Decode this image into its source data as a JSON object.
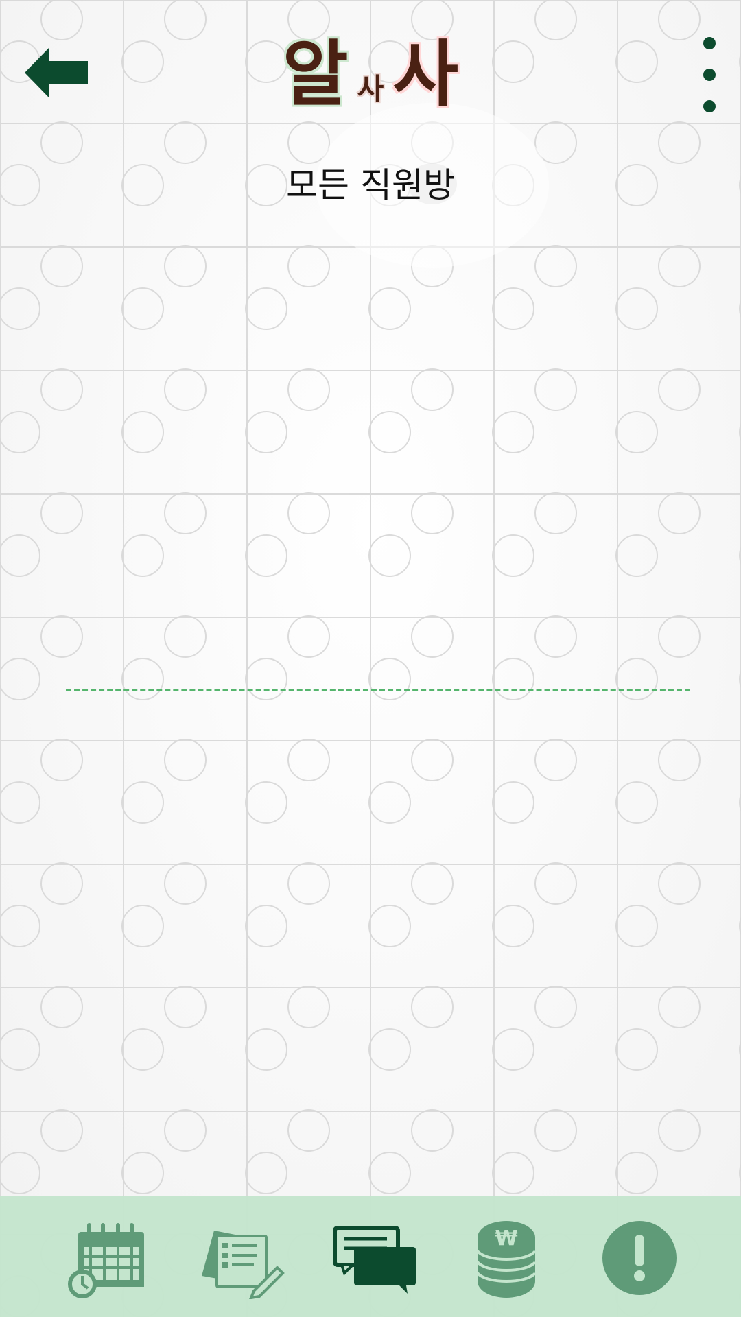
{
  "header": {
    "logo": {
      "parts": [
        "알",
        "사",
        "사"
      ]
    }
  },
  "main": {
    "title": "모든 직원방"
  },
  "bottom_nav": [
    {
      "icon": "calendar-clock-icon",
      "active": false
    },
    {
      "icon": "checklist-pencil-icon",
      "active": false
    },
    {
      "icon": "chat-bubbles-icon",
      "active": true
    },
    {
      "icon": "won-coins-icon",
      "active": false
    },
    {
      "icon": "alert-icon",
      "active": false
    }
  ],
  "colors": {
    "accent": "#0c4b2e",
    "nav_inactive": "#5f9b78",
    "nav_bg": "#c4e5cd",
    "divider": "#55b56d",
    "logo_text": "#4a2113"
  }
}
